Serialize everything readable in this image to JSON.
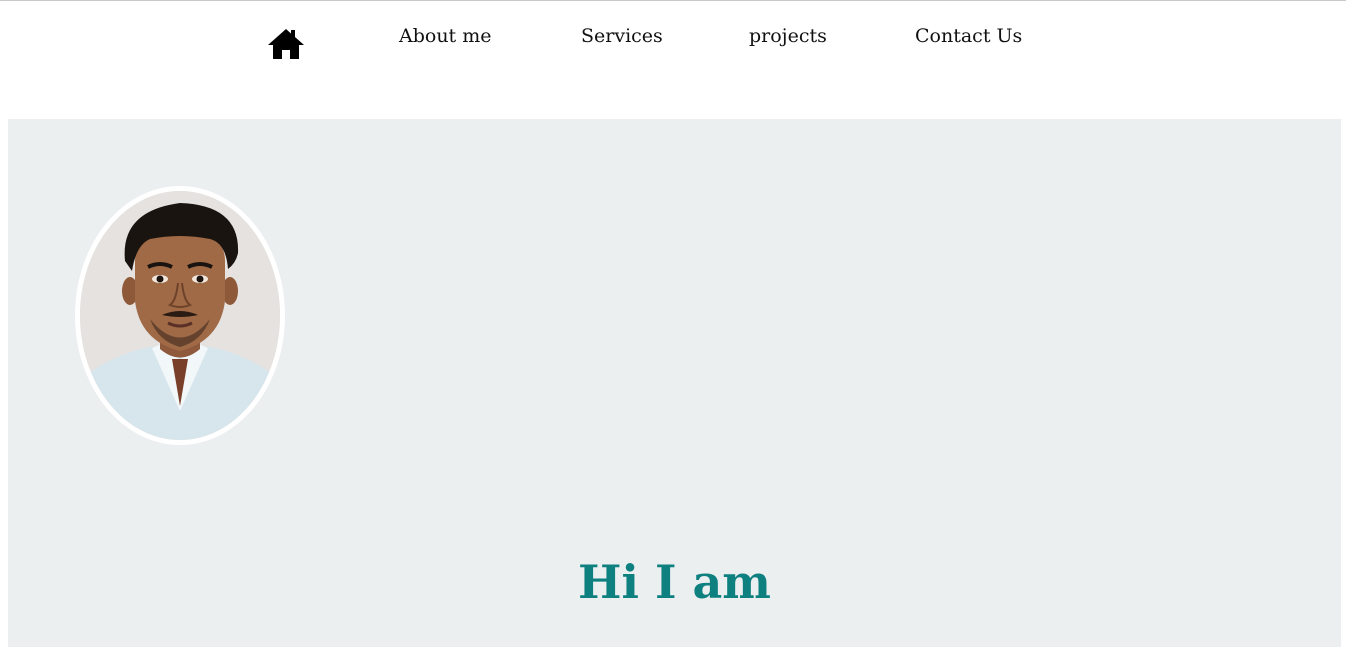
{
  "nav": {
    "home_icon": "house-icon",
    "links": [
      {
        "label": "About me"
      },
      {
        "label": "Services"
      },
      {
        "label": "projects"
      },
      {
        "label": "Contact Us"
      }
    ]
  },
  "hero": {
    "avatar_alt": "profile photo",
    "heading": "Hi I am"
  },
  "colors": {
    "hero_background": "#eceff0",
    "heading": "#0e8080",
    "nav_text": "#111111",
    "avatar_border": "#ffffff"
  }
}
